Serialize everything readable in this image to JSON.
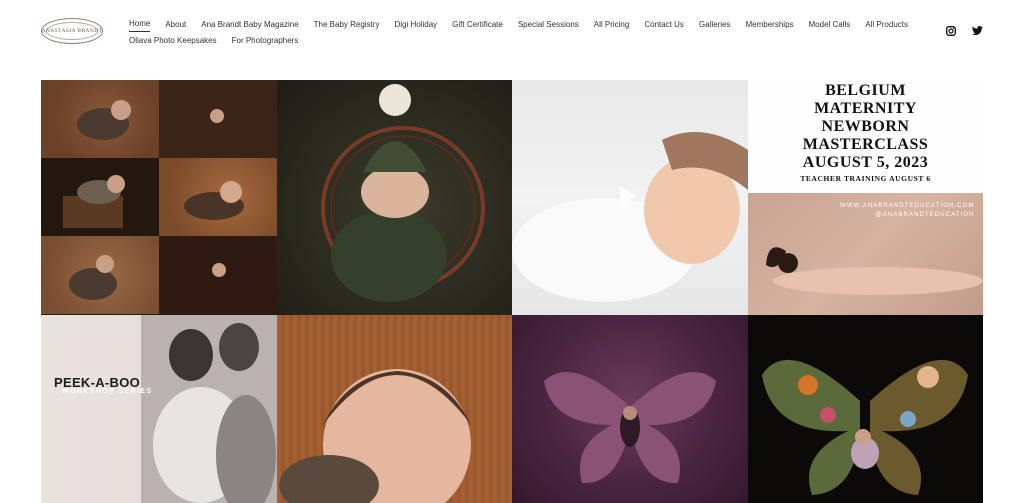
{
  "header": {
    "logo_text": "ANASTASIA BRANDT",
    "nav_row1": [
      {
        "label": "Home",
        "active": true
      },
      {
        "label": "About"
      },
      {
        "label": "Ana Brandt Baby Magazine"
      },
      {
        "label": "The Baby Registry"
      },
      {
        "label": "Digi Holiday"
      },
      {
        "label": "Gift Certificate"
      },
      {
        "label": "Special Sessions"
      },
      {
        "label": "All Pricing"
      },
      {
        "label": "Contact Us"
      },
      {
        "label": "Galleries"
      },
      {
        "label": "Memberships"
      },
      {
        "label": "Model Calls"
      },
      {
        "label": "All Products"
      }
    ],
    "nav_row2": [
      {
        "label": "Oliava Photo Keepsakes"
      },
      {
        "label": "For Photographers"
      }
    ],
    "social": [
      "instagram-icon",
      "twitter-icon"
    ]
  },
  "gallery": {
    "masterclass": {
      "lines": [
        "BELGIUM",
        "MATERNITY",
        "NEWBORN",
        "MASTERCLASS",
        "AUGUST 5, 2023"
      ],
      "sub": "TEACHER TRAINING AUGUST 6"
    },
    "maternity_promo": {
      "site": "WWW.ANABRANDTEDUCATION.COM",
      "handle": "@ANABRANDTEDUCATION"
    },
    "peekaboo": {
      "title": "PEEK-A-BOO",
      "sub": "WORKSHOP SERIES"
    }
  }
}
